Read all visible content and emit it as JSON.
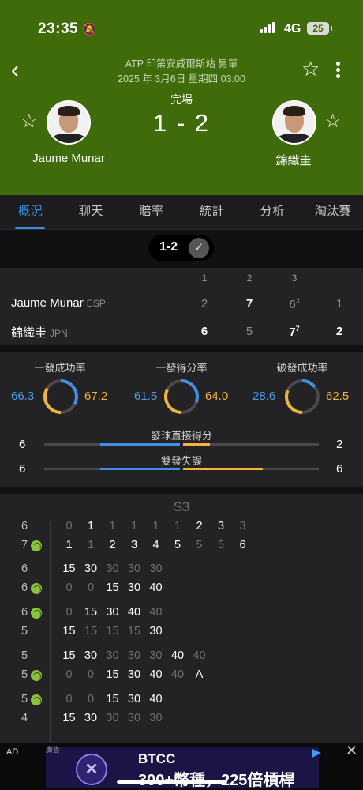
{
  "status_bar": {
    "time": "23:35",
    "network": "4G",
    "battery": "25"
  },
  "header": {
    "event": "ATP 印第安威爾斯站 男單",
    "date": "2025 年 3月6日 星期四 03:00",
    "match_status": "完場",
    "score": "1 - 2",
    "player_left": "Jaume Munar",
    "player_right": "錦織圭"
  },
  "tabs": [
    "概況",
    "聊天",
    "賠率",
    "統計",
    "分析",
    "淘汰賽"
  ],
  "set_selector": {
    "label": "1-2"
  },
  "sets_table": {
    "columns": [
      "1",
      "2",
      "3"
    ],
    "rows": [
      {
        "name": "Jaume Munar",
        "country": "ESP",
        "s1": "2",
        "s2": "7",
        "s3": "6",
        "s3_tb": "3",
        "total": "1"
      },
      {
        "name": "錦織圭",
        "country": "JPN",
        "s1": "6",
        "s2": "5",
        "s3": "7",
        "s3_tb": "7",
        "total": "2"
      }
    ]
  },
  "stats": {
    "rings": [
      {
        "title": "一發成功率",
        "left": "66.3",
        "right": "67.2",
        "left_val": 66.3,
        "right_val": 67.2
      },
      {
        "title": "一發得分率",
        "left": "61.5",
        "right": "64.0",
        "left_val": 61.5,
        "right_val": 64.0
      },
      {
        "title": "破發成功率",
        "left": "28.6",
        "right": "62.5",
        "left_val": 28.6,
        "right_val": 62.5
      }
    ],
    "bars": [
      {
        "label": "發球直接得分",
        "left": "6",
        "right": "2",
        "left_val": 6,
        "right_val": 2
      },
      {
        "label": "雙發失誤",
        "left": "6",
        "right": "6",
        "left_val": 6,
        "right_val": 6
      }
    ]
  },
  "point_by_point": {
    "title": "S3",
    "tiebreak": {
      "top_game": "6",
      "bottom_game": "7",
      "top": [
        "0",
        "1",
        "1",
        "1",
        "1",
        "1",
        "2",
        "3",
        "3"
      ],
      "bottom": [
        "1",
        "1",
        "2",
        "3",
        "4",
        "5",
        "5",
        "5",
        "6"
      ]
    },
    "games": [
      {
        "top_game": "6",
        "bottom_game": "6",
        "server": "bottom",
        "top": [
          "15",
          "30",
          "30",
          "30",
          "30"
        ],
        "bottom": [
          "0",
          "0",
          "15",
          "30",
          "40"
        ]
      },
      {
        "top_game": "6",
        "bottom_game": "5",
        "server": "top",
        "top": [
          "0",
          "15",
          "30",
          "40",
          "40"
        ],
        "bottom": [
          "15",
          "15",
          "15",
          "15",
          "30"
        ]
      },
      {
        "top_game": "5",
        "bottom_game": "5",
        "server": "bottom",
        "top": [
          "15",
          "30",
          "30",
          "30",
          "30",
          "40",
          "40"
        ],
        "bottom": [
          "0",
          "0",
          "15",
          "30",
          "40",
          "40",
          "A"
        ]
      },
      {
        "top_game": "5",
        "bottom_game": "4",
        "server": "top",
        "top": [
          "0",
          "0",
          "15",
          "30",
          "40"
        ],
        "bottom": [
          "15",
          "30",
          "30",
          "30",
          "30"
        ]
      }
    ]
  },
  "ad": {
    "tag": "AD",
    "small": "廣告",
    "brand": "BTCC",
    "copy": "300+幣種，225倍槓桿"
  }
}
